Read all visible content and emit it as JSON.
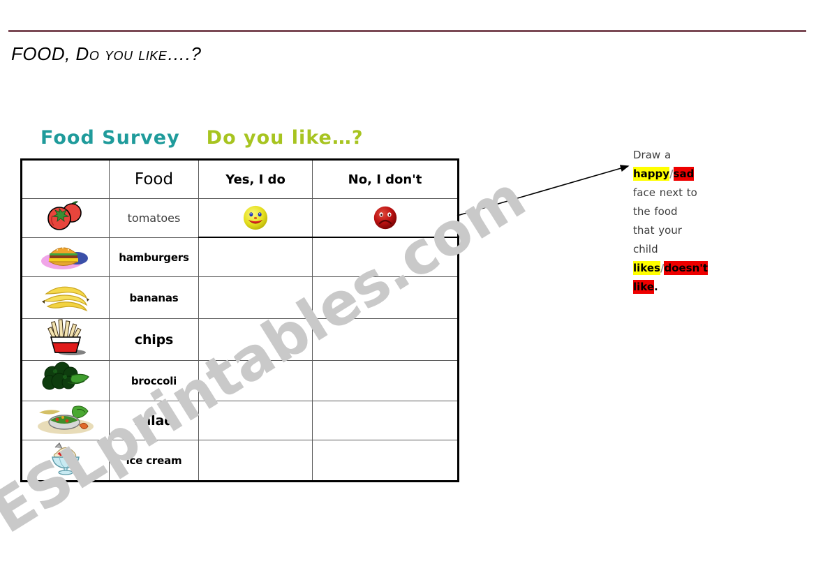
{
  "page": {
    "title": "FOOD, Do you like….?",
    "watermark": "ESLprintables.com"
  },
  "heading": {
    "main": "Food Survey",
    "sub": "Do you like…?",
    "main_color": "#1f9b9b",
    "sub_color": "#a7c420"
  },
  "table": {
    "columns": [
      "",
      "Food",
      "Yes, I do",
      "No, I don't"
    ],
    "rows": [
      {
        "food": "tomatoes",
        "picture": "tomatoes-image",
        "yes": "happy-face-icon",
        "no": "sad-face-icon"
      },
      {
        "food": "hamburgers",
        "picture": "hamburger-image",
        "yes": "",
        "no": ""
      },
      {
        "food": "bananas",
        "picture": "bananas-image",
        "yes": "",
        "no": ""
      },
      {
        "food": "chips",
        "picture": "chips-image",
        "yes": "",
        "no": ""
      },
      {
        "food": "broccoli",
        "picture": "broccoli-image",
        "yes": "",
        "no": ""
      },
      {
        "food": "salad",
        "picture": "salad-image",
        "yes": "",
        "no": ""
      },
      {
        "food": "ice cream",
        "picture": "ice-cream-image",
        "yes": "",
        "no": ""
      }
    ]
  },
  "instructions": {
    "line1": "Draw a",
    "happy": "happy",
    "sad": "sad",
    "line2": "face next to",
    "line3": "the food",
    "line4": "that your",
    "line5": "child",
    "likes": "likes",
    "doesnt_like": "doesn't like",
    "period": ".",
    "separator": "/",
    "highlight_yes_color": "#ffff00",
    "highlight_no_color": "#ee0000"
  },
  "colors": {
    "top_rule": "#7b4a55",
    "happy_face": "#e8e020",
    "sad_face": "#b81414"
  }
}
